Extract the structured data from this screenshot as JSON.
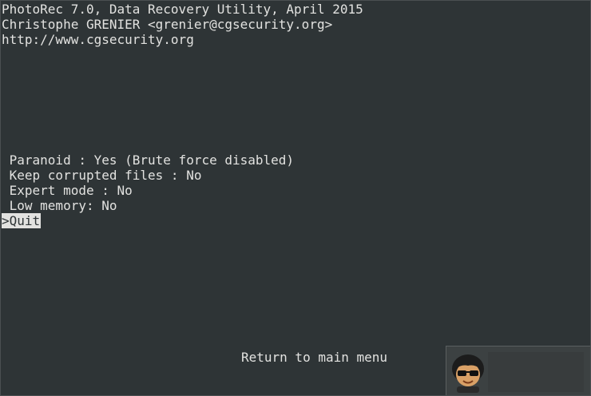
{
  "header": {
    "line1": "PhotoRec 7.0, Data Recovery Utility, April 2015",
    "line2": "Christophe GRENIER <grenier@cgsecurity.org>",
    "line3": "http://www.cgsecurity.org"
  },
  "options": [
    {
      "label": " Paranoid : Yes (Brute force disabled)"
    },
    {
      "label": " Keep corrupted files : No"
    },
    {
      "label": " Expert mode : No"
    },
    {
      "label": " Low memory: No"
    }
  ],
  "quit_label": ">Quit",
  "footer": {
    "return_label": "Return to main menu"
  },
  "colors": {
    "background": "#2e3436",
    "text": "#e2e2e0",
    "highlight_bg": "#e2e2e0",
    "highlight_fg": "#2e3436"
  },
  "icons": {
    "corner": "avatar-with-sunglasses-icon"
  }
}
